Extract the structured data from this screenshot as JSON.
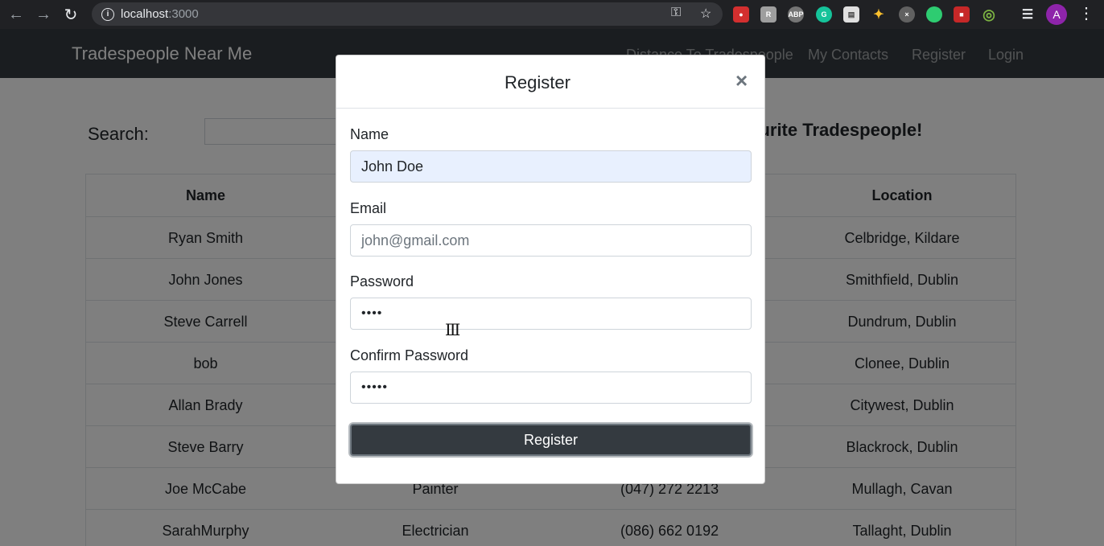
{
  "browser": {
    "url_host": "localhost",
    "url_port": ":3000",
    "avatar_letter": "A"
  },
  "navbar": {
    "brand": "Tradespeople Near Me",
    "links": [
      "Distance To Tradespeople",
      "My Contacts",
      "Register",
      "Login"
    ]
  },
  "page": {
    "search_label": "Search:",
    "tagline": "ourite Tradespeople!"
  },
  "table": {
    "headers": [
      "Name",
      "",
      "",
      "Location"
    ],
    "rows": [
      [
        "Ryan Smith",
        "",
        "",
        "Celbridge, Kildare"
      ],
      [
        "John Jones",
        "",
        "",
        "Smithfield, Dublin"
      ],
      [
        "Steve Carrell",
        "",
        "",
        "Dundrum, Dublin"
      ],
      [
        "bob",
        "",
        "",
        "Clonee, Dublin"
      ],
      [
        "Allan Brady",
        "",
        "",
        "Citywest, Dublin"
      ],
      [
        "Steve Barry",
        "",
        "",
        "Blackrock, Dublin"
      ],
      [
        "Joe McCabe",
        "Painter",
        "(047) 272 2213",
        "Mullagh, Cavan"
      ],
      [
        "SarahMurphy",
        "Electrician",
        "(086) 662 0192",
        "Tallaght, Dublin"
      ]
    ]
  },
  "modal": {
    "title": "Register",
    "close": "×",
    "name_label": "Name",
    "name_value": "John Doe",
    "email_label": "Email",
    "email_placeholder": "john@gmail.com",
    "password_label": "Password",
    "password_value": "••••",
    "confirm_label": "Confirm Password",
    "confirm_value": "•••••",
    "submit": "Register"
  }
}
